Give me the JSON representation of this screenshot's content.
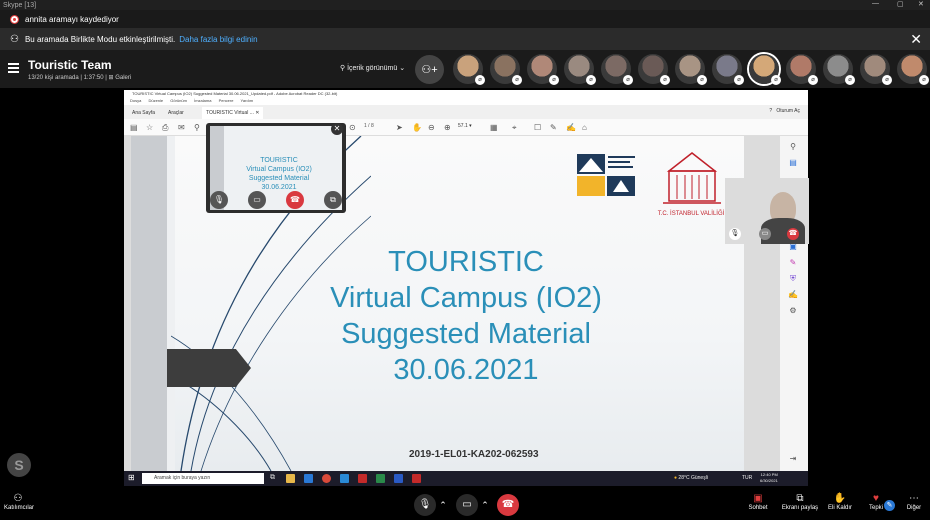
{
  "window": {
    "title": "Skype [13]"
  },
  "recording": {
    "text": "annita aramayı kaydediyor"
  },
  "together_mode": {
    "text": "Bu aramada Birlikte Modu etkinleştirilmişti.",
    "link": "Daha fazla bilgi edinin"
  },
  "header": {
    "title": "Touristic Team",
    "subtitle": "13/20 kişi aramada | 1:37:50 | ⊞ Galeri",
    "view_label": "İçerik görünümü"
  },
  "participants": [
    {
      "color": "#c9a27c"
    },
    {
      "color": "#8a7260"
    },
    {
      "color": "#b08878"
    },
    {
      "color": "#9a8a80"
    },
    {
      "color": "#7c6a64"
    },
    {
      "color": "#6a5a56"
    },
    {
      "color": "#a89484"
    },
    {
      "color": "#7a7a8a"
    },
    {
      "color": "#d4a878",
      "active": true
    },
    {
      "color": "#b07a68"
    },
    {
      "color": "#8c8c8c"
    },
    {
      "color": "#a08a7c"
    },
    {
      "color": "#c08a6c"
    }
  ],
  "shared_screen": {
    "acrobat_title": "TOURISTIC Virtual Campus (IO2) Suggested Material 30.06.2021_Updated.pdf - Adobe Acrobat Reader DC (32-bit)",
    "menu": [
      "Dosya",
      "Düzenle",
      "Görünüm",
      "İmzalama",
      "Pencere",
      "Yardım"
    ],
    "tabs": [
      "Ana Sayfa",
      "Araçlar",
      "TOURISTIC Virtual ..."
    ],
    "sign_in": "Oturum Aç",
    "page_display": "1 / 8",
    "zoom": "57.1",
    "slide": {
      "title_lines": [
        "TOURISTIC",
        "Virtual Campus (IO2)",
        "Suggested Material",
        "30.06.2021"
      ],
      "code": "2019-1-EL01-KA202-062593",
      "logo2_caption": "T.C. İSTANBUL VALİLİĞİ"
    },
    "taskbar": {
      "search_placeholder": "Aramak için buraya yazın",
      "weather": "28°C Güneşli",
      "lang": "TUR",
      "time": "12:40 PM",
      "date": "6/30/2021"
    }
  },
  "mini_call": {
    "title_lines": [
      "TOURISTIC",
      "Virtual Campus (IO2)",
      "Suggested Material",
      "30.06.2021"
    ]
  },
  "bottom": {
    "participants_label": "Katılımcılar",
    "chat_label": "Sohbet",
    "share_label": "Ekranı paylaş",
    "raise_label": "Eli Kaldır",
    "react_label": "Tepki",
    "more_label": "Diğer"
  },
  "colors": {
    "accent": "#2a8fb8",
    "end_call": "#d9393f",
    "link": "#4fb0ff"
  }
}
